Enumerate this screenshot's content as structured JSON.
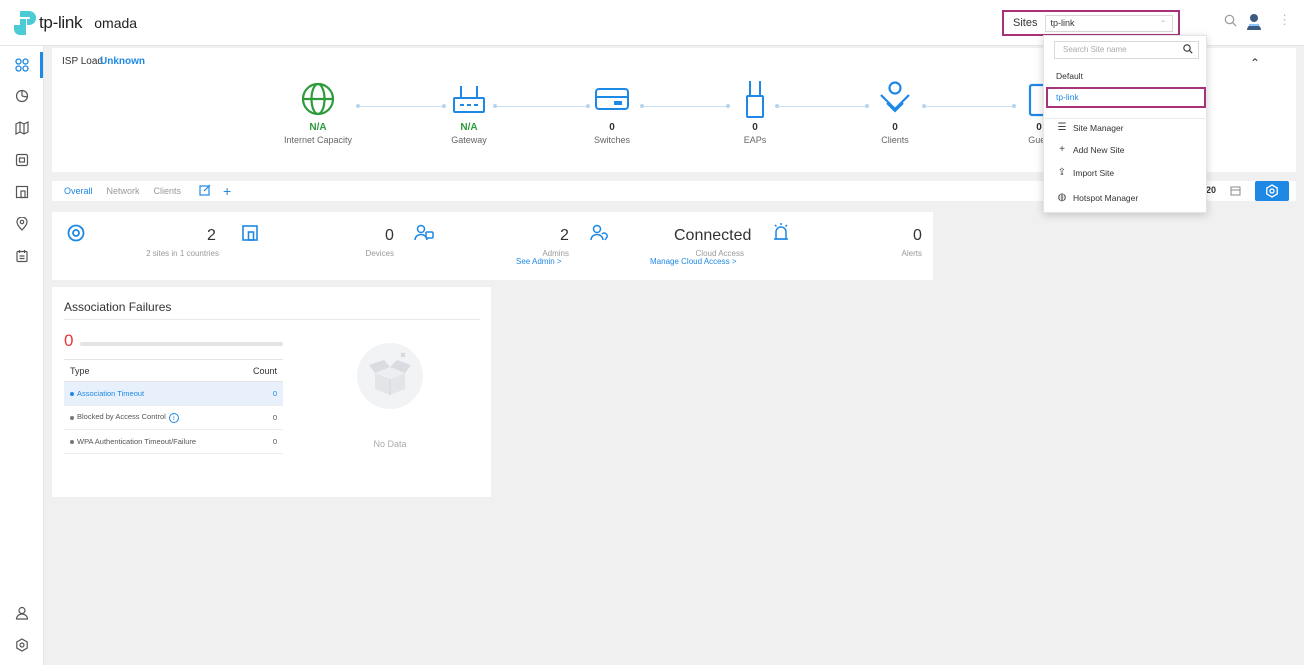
{
  "header": {
    "brand": "tp-link",
    "product": "omada",
    "sites_label": "Sites",
    "selected_site": "tp-link"
  },
  "site_dropdown": {
    "search_placeholder": "Search Site name",
    "sites": [
      "Default",
      "tp-link"
    ],
    "selected": "tp-link",
    "actions": [
      {
        "label": "Site Manager",
        "icon": "list-icon"
      },
      {
        "label": "Add New Site",
        "icon": "plus-icon"
      },
      {
        "label": "Import Site",
        "icon": "upload-icon"
      },
      {
        "label": "Hotspot Manager",
        "icon": "hotspot-icon"
      }
    ]
  },
  "isp": {
    "label": "ISP Load",
    "status": "Unknown",
    "topology": [
      {
        "value": "N/A",
        "label": "Internet Capacity",
        "icon": "globe-icon"
      },
      {
        "value": "N/A",
        "label": "Gateway",
        "icon": "router-icon"
      },
      {
        "value": "0",
        "label": "Switches",
        "icon": "switch-icon"
      },
      {
        "value": "0",
        "label": "EAPs",
        "icon": "access-point-icon"
      },
      {
        "value": "0",
        "label": "Clients",
        "icon": "client-icon"
      },
      {
        "value": "0",
        "label": "Gues",
        "icon": "guest-icon"
      }
    ]
  },
  "tabs": {
    "items": [
      "Overall",
      "Network",
      "Clients"
    ],
    "active": "Overall",
    "time_value": "20"
  },
  "summary": {
    "sites_count": "2",
    "sites_sub": "2 sites in 1 countries",
    "devices_count": "0",
    "devices_label": "Devices",
    "admins_count": "2",
    "admins_label": "Admins",
    "admins_link": "See Admin >",
    "cloud_status": "Connected",
    "cloud_label": "Cloud Access",
    "cloud_link": "Manage Cloud Access >",
    "alerts_count": "0",
    "alerts_label": "Alerts"
  },
  "association_failures": {
    "title": "Association Failures",
    "total": "0",
    "columns": [
      "Type",
      "Count"
    ],
    "rows": [
      {
        "type": "Association Timeout",
        "count": "0"
      },
      {
        "type": "Blocked by Access Control",
        "count": "0"
      },
      {
        "type": "WPA Authentication Timeout/Failure",
        "count": "0"
      }
    ],
    "no_data": "No Data"
  },
  "colors": {
    "accent": "#1e88e5",
    "highlight_border": "#a8327a",
    "brand_green": "#2e9b3a",
    "alert_red": "#e53935"
  }
}
